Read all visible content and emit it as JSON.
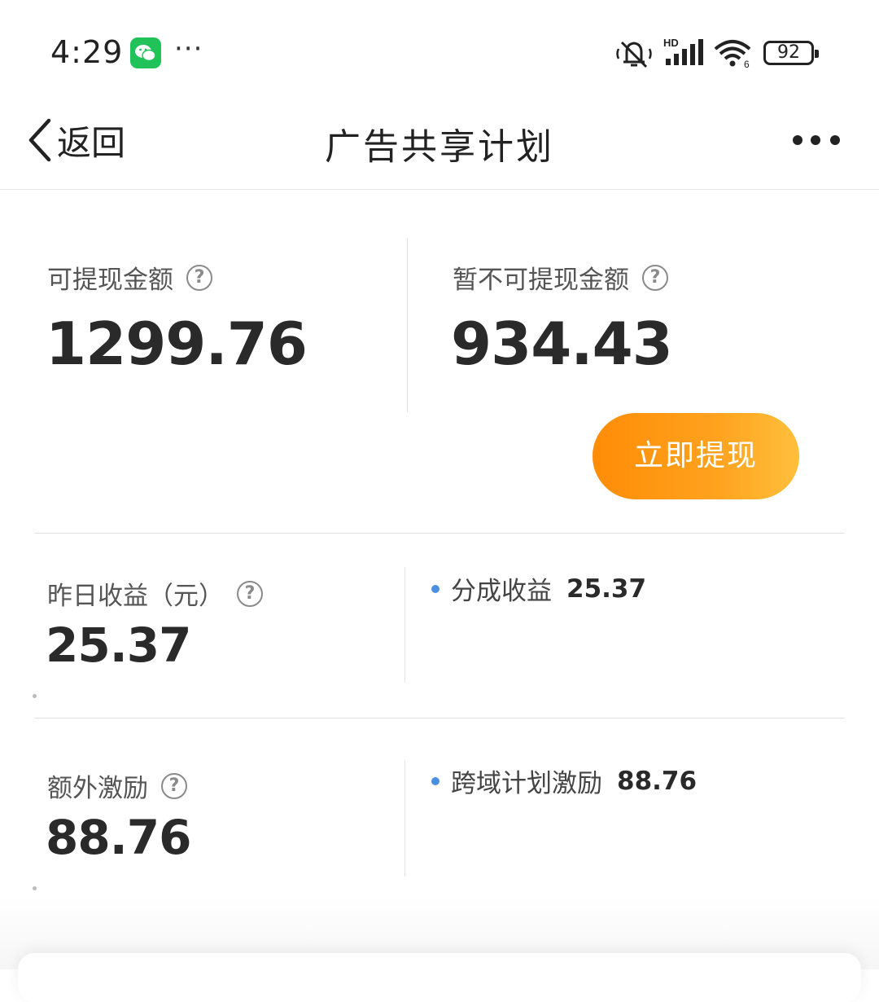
{
  "status_bar": {
    "time": "4:29",
    "more_dots": "···",
    "battery": "92",
    "icons": [
      "wechat-icon",
      "mute-icon",
      "hd-signal-icon",
      "wifi-icon",
      "battery-icon"
    ]
  },
  "nav": {
    "back_label": "返回",
    "title": "广告共享计划",
    "icons": [
      "back-arrow-icon",
      "more-icon"
    ]
  },
  "balance": {
    "withdrawable_label": "可提现金额",
    "withdrawable_amount": "1299.76",
    "pending_label": "暂不可提现金额",
    "pending_amount": "934.43",
    "withdraw_button": "立即提现"
  },
  "yesterday": {
    "label": "昨日收益（元）",
    "amount": "25.37",
    "detail_label": "分成收益",
    "detail_value": "25.37"
  },
  "extra": {
    "label": "额外激励",
    "amount": "88.76",
    "detail_label": "跨域计划激励",
    "detail_value": "88.76"
  },
  "help_icon_glyph": "?",
  "colors": {
    "button_gradient_start": "#ff8c06",
    "button_gradient_end": "#ffc03c",
    "detail_dot": "#4a8fe0",
    "wechat_green": "#21c25a"
  }
}
